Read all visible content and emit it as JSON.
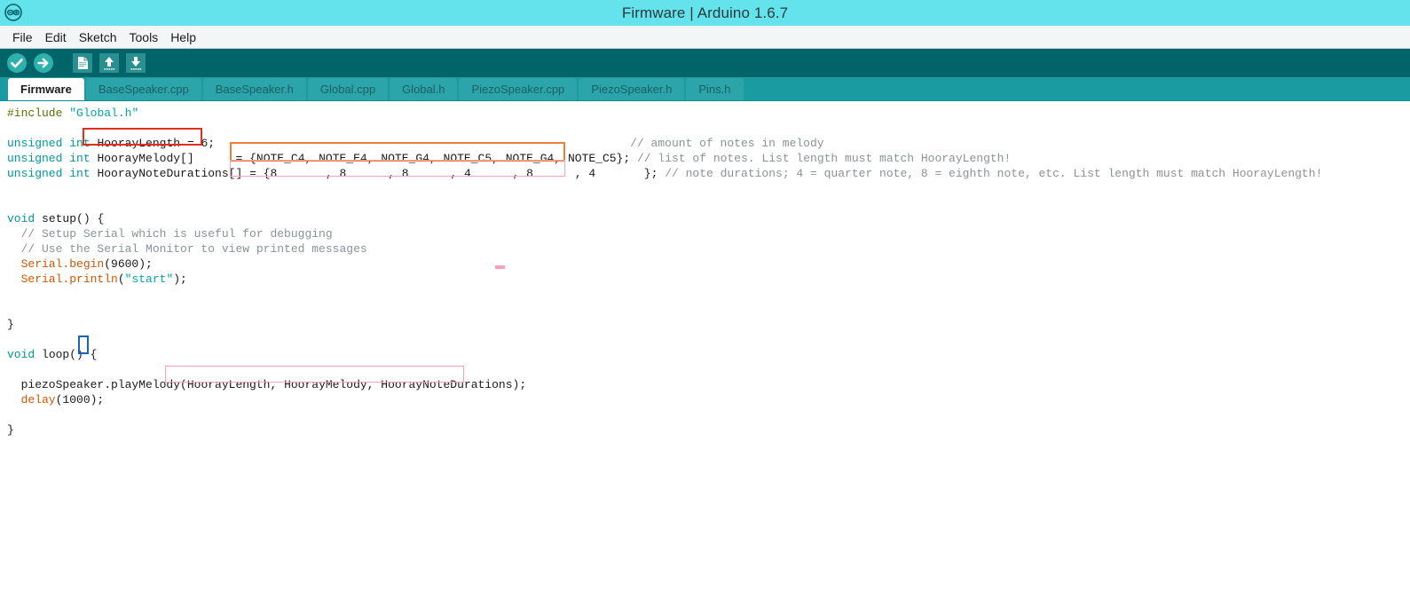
{
  "window": {
    "title": "Firmware | Arduino 1.6.7",
    "logo_icon": "arduino-infinity-icon",
    "colors": {
      "titlebar": "#65e3ec",
      "menubar": "#f4f5f6",
      "toolbar": "#006468",
      "tabbar": "#1a9ba1",
      "tab_active": "#ffffff",
      "editor": "#ffffff",
      "accent_keyword": "#00979c",
      "accent_function": "#d35400",
      "comment": "#8a9396",
      "preprocessor": "#5e6d03",
      "string": "#00a4a6",
      "box_red": "#e03020",
      "box_orange": "#ef7f3a",
      "box_pink": "#f3a4b5",
      "box_blue": "#1d63b8"
    }
  },
  "menu": {
    "items": [
      {
        "label": "File"
      },
      {
        "label": "Edit"
      },
      {
        "label": "Sketch"
      },
      {
        "label": "Tools"
      },
      {
        "label": "Help"
      }
    ]
  },
  "toolbar": {
    "buttons": [
      {
        "name": "verify-button",
        "icon": "checkmark-icon",
        "label": "Verify"
      },
      {
        "name": "upload-button",
        "icon": "arrow-right-icon",
        "label": "Upload"
      },
      {
        "name": "new-button",
        "icon": "document-icon",
        "label": "New"
      },
      {
        "name": "open-button",
        "icon": "arrow-up-icon",
        "label": "Open"
      },
      {
        "name": "save-button",
        "icon": "arrow-down-icon",
        "label": "Save"
      }
    ]
  },
  "tabs": [
    {
      "label": "Firmware",
      "active": true
    },
    {
      "label": "BaseSpeaker.cpp",
      "active": false
    },
    {
      "label": "BaseSpeaker.h",
      "active": false
    },
    {
      "label": "Global.cpp",
      "active": false
    },
    {
      "label": "Global.h",
      "active": false
    },
    {
      "label": "PiezoSpeaker.cpp",
      "active": false
    },
    {
      "label": "PiezoSpeaker.h",
      "active": false
    },
    {
      "label": "Pins.h",
      "active": false
    }
  ],
  "code": {
    "l1_include": "#include",
    "l1_header": "\"Global.h\"",
    "l3_type": "unsigned int",
    "l3_decl": "HoorayLength = 6;",
    "l3_comment": "// amount of notes in melody",
    "l4_type": "unsigned int",
    "l4_name": "HoorayMelody[]",
    "l4_eq": "=",
    "l4_array": "{NOTE_C4, NOTE_E4, NOTE_G4, NOTE_C5, NOTE_G4, NOTE_C5}",
    "l4_semi": ";",
    "l4_comment": "// list of notes. List length must match HoorayLength!",
    "l5_type": "unsigned int",
    "l5_name": "HoorayNoteDurations[]",
    "l5_eq": "=",
    "l5_array": "{8       , 8      , 8      , 4      , 8      , 4       }",
    "l5_semi": ";",
    "l5_comment": "// note durations; 4 = quarter note, 8 = eighth note, etc. List length must match HoorayLength!",
    "l7_void": "void",
    "l7_setup": "setup",
    "l7_rest": "() {",
    "l8_comment": "  // Setup Serial which is useful for debugging",
    "l9_comment": "  // Use the Serial Monitor to view printed messages",
    "l10_obj": "  Serial.begin",
    "l10_args": "(9600);",
    "l11_obj": "  Serial.println",
    "l11_open": "(",
    "l11_str": "\"start\"",
    "l11_close": ");",
    "l13_close": "}",
    "l15_void": "void",
    "l15_loop": "loop",
    "l15_paren": "() ",
    "l15_brace": "{",
    "l17_call": "  piezoSpeaker.playMelody",
    "l17_args": "(HoorayLength, HoorayMelody, HoorayNoteDurations)",
    "l17_semi": ";",
    "l18_fn": "  delay",
    "l18_args": "(1000);",
    "l20_close": "}"
  },
  "annotations": [
    {
      "name": "highlight-hooray-length",
      "color": "red"
    },
    {
      "name": "highlight-hooray-melody-array",
      "color": "orange"
    },
    {
      "name": "highlight-hooray-note-durations-array",
      "color": "pink"
    },
    {
      "name": "bracket-match-highlight",
      "color": "blue"
    },
    {
      "name": "highlight-play-melody-args",
      "color": "pink"
    },
    {
      "name": "text-cursor-marker",
      "color": "pink"
    }
  ]
}
